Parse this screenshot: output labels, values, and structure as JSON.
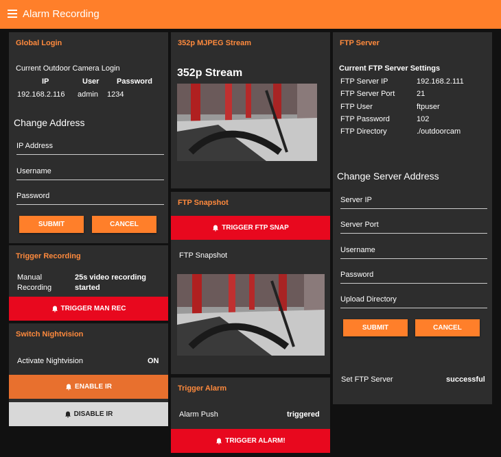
{
  "app": {
    "title": "Alarm Recording"
  },
  "global_login": {
    "title": "Global Login",
    "current_label": "Current Outdoor Camera Login",
    "headers": [
      "IP",
      "User",
      "Password"
    ],
    "row": [
      "192.168.2.116",
      "admin",
      "1234"
    ],
    "change_heading": "Change Address",
    "fields": [
      "IP Address",
      "Username",
      "Password"
    ],
    "submit": "SUBMIT",
    "cancel": "CANCEL"
  },
  "trigger_recording": {
    "title": "Trigger Recording",
    "label": "Manual Recording",
    "label_line1": "Manual",
    "label_line2": "Recording",
    "status_line1": "25s video recording",
    "status_line2": "started",
    "button": "TRIGGER MAN REC"
  },
  "nightvision": {
    "title": "Switch Nightvision",
    "label": "Activate Nightvision",
    "value": "ON",
    "enable": "ENABLE IR",
    "disable": "DISABLE IR"
  },
  "stream": {
    "title": "352p MJPEG Stream",
    "heading": "352p Stream"
  },
  "ftp_snapshot": {
    "title": "FTP Snapshot",
    "button": "TRIGGER FTP SNAP",
    "label": "FTP Snapshot"
  },
  "alarm": {
    "title": "Trigger Alarm",
    "label": "Alarm Push",
    "value": "triggered",
    "button": "TRIGGER ALARM!"
  },
  "ftp_server": {
    "title": "FTP Server",
    "current_heading": "Current FTP Server Settings",
    "settings": [
      {
        "key": "FTP Server IP",
        "value": "192.168.2.111"
      },
      {
        "key": "FTP Server Port",
        "value": "21"
      },
      {
        "key": "FTP User",
        "value": "ftpuser"
      },
      {
        "key": "FTP Password",
        "value": "102"
      },
      {
        "key": "FTP Directory",
        "value": "./outdoorcam"
      }
    ],
    "change_heading": "Change Server Address",
    "fields": [
      "Server IP",
      "Server Port",
      "Username",
      "Password",
      "Upload Directory"
    ],
    "submit": "SUBMIT",
    "cancel": "CANCEL",
    "status_label": "Set FTP Server",
    "status_value": "successful"
  },
  "colors": {
    "accent": "#ff7f2a",
    "alarm_red": "#e8081e",
    "card_bg": "#2d2d2d",
    "title_orange": "#ff8a3d"
  }
}
